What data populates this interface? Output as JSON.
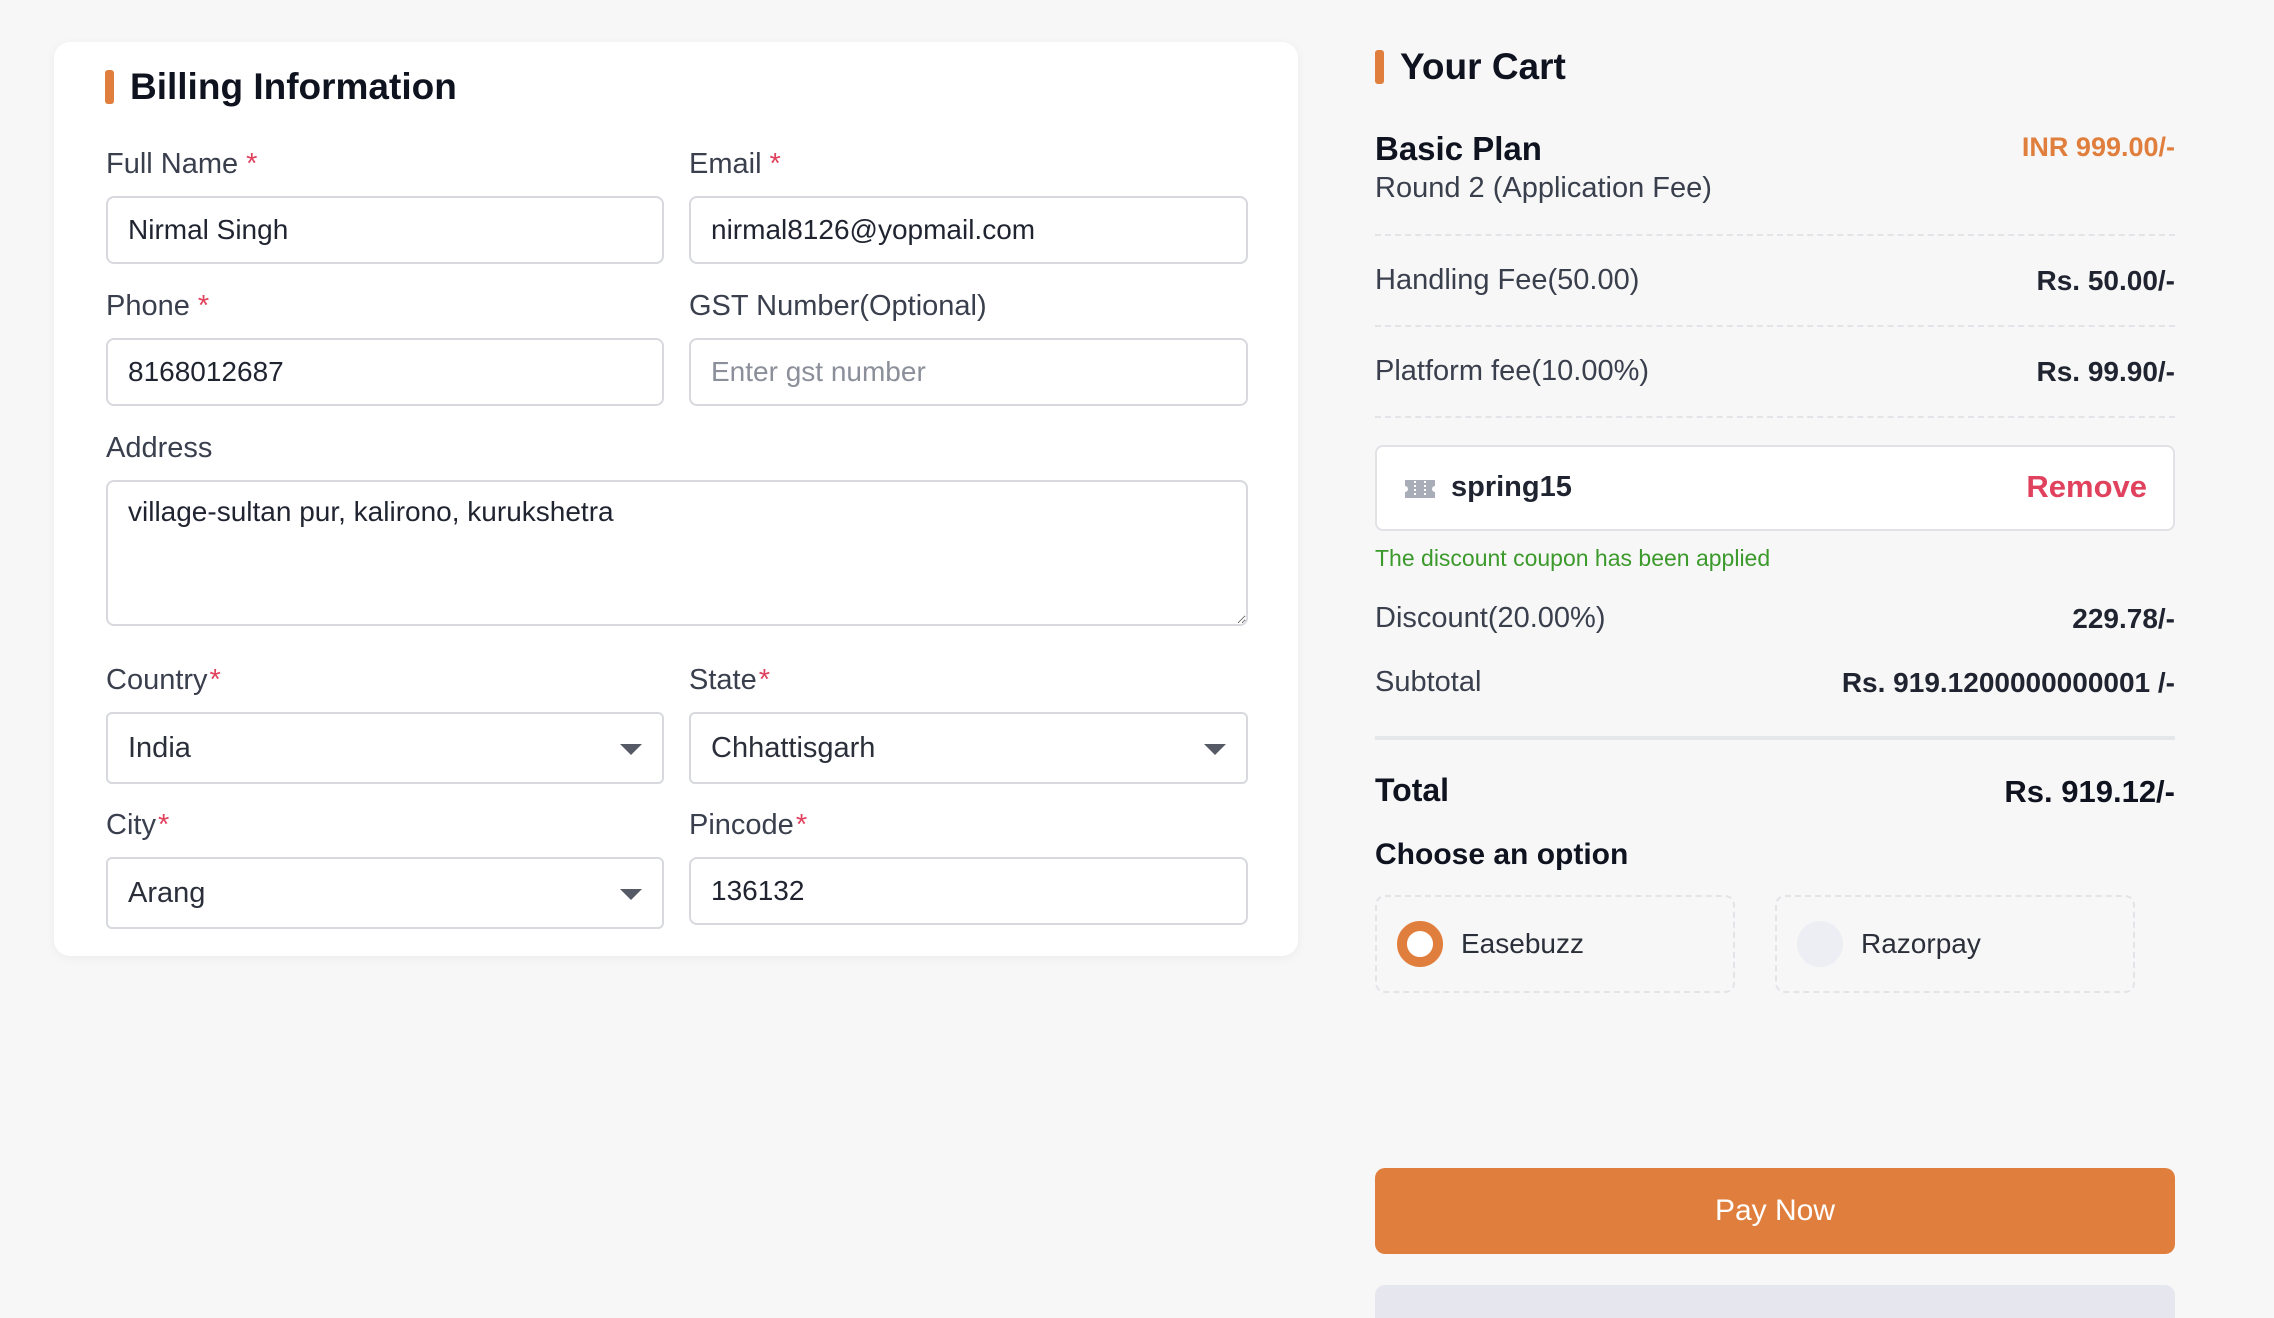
{
  "billing": {
    "title": "Billing Information",
    "full_name": {
      "label": "Full Name",
      "required_mark": "*",
      "value": "Nirmal Singh"
    },
    "email": {
      "label": "Email",
      "required_mark": "*",
      "value": "nirmal8126@yopmail.com"
    },
    "phone": {
      "label": "Phone",
      "required_mark": "*",
      "value": "8168012687"
    },
    "gst": {
      "label": "GST Number(Optional)",
      "value": "",
      "placeholder": "Enter gst number"
    },
    "address": {
      "label": "Address",
      "value": "village-sultan pur, kalirono, kurukshetra"
    },
    "country": {
      "label": "Country",
      "required_mark": "*",
      "value": "India"
    },
    "state": {
      "label": "State",
      "required_mark": "*",
      "value": "Chhattisgarh"
    },
    "city": {
      "label": "City",
      "required_mark": "*",
      "value": "Arang"
    },
    "pincode": {
      "label": "Pincode",
      "required_mark": "*",
      "value": "136132"
    }
  },
  "cart": {
    "title": "Your Cart",
    "plan_name": "Basic Plan",
    "plan_sub": "Round 2 (Application Fee)",
    "plan_price": "INR 999.00/-",
    "handling_label": "Handling Fee(50.00)",
    "handling_value": "Rs. 50.00/-",
    "platform_label": "Platform fee(10.00%)",
    "platform_value": "Rs. 99.90/-",
    "coupon_code": "spring15",
    "remove_label": "Remove",
    "coupon_message": "The discount coupon has been applied",
    "discount_label": "Discount(20.00%)",
    "discount_value": "229.78/-",
    "subtotal_label": "Subtotal",
    "subtotal_value": "Rs. 919.1200000000001 /-",
    "total_label": "Total",
    "total_value": "Rs. 919.12/-",
    "choose_label": "Choose an option",
    "options": [
      {
        "label": "Easebuzz",
        "selected": true
      },
      {
        "label": "Razorpay",
        "selected": false
      }
    ],
    "pay_label": "Pay Now"
  },
  "colors": {
    "accent": "#e07f3d",
    "required": "#e0425e",
    "success": "#3c9a2c",
    "remove": "#e0425e"
  },
  "icons": {
    "coupon": "ticket-icon",
    "dropdown": "chevron-down-icon"
  }
}
